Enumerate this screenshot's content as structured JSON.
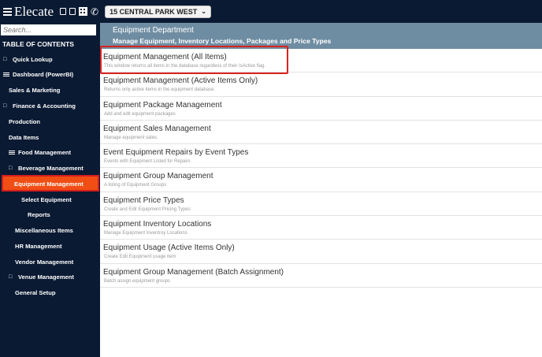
{
  "topbar": {
    "logo": "Elecate",
    "venue_selector": "15 CENTRAL PARK WEST",
    "icons": [
      "menu-icon",
      "window-icon",
      "window-icon",
      "building-icon",
      "phone-icon",
      "chevron-down-icon"
    ]
  },
  "sidebar": {
    "search_placeholder": "Search...",
    "toc_title": "TABLE OF CONTENTS",
    "items": [
      {
        "label": "Quick Lookup"
      },
      {
        "label": "Dashboard (PowerBI)"
      },
      {
        "label": "Sales & Marketing"
      },
      {
        "label": "Finance & Accounting"
      },
      {
        "label": "Production"
      },
      {
        "label": "Data Items"
      },
      {
        "label": "Food Management"
      },
      {
        "label": "Beverage Management"
      },
      {
        "label": "Equipment Management"
      },
      {
        "label": "Select Equipment"
      },
      {
        "label": "Reports"
      },
      {
        "label": "Miscellaneous Items"
      },
      {
        "label": "HR Management"
      },
      {
        "label": "Vendor Management"
      },
      {
        "label": "Venue Management"
      },
      {
        "label": "General Setup"
      }
    ]
  },
  "header": {
    "title": "Equipment Department",
    "subtitle": "Manage Equipment, Inventory Locations, Packages and Price Types"
  },
  "rows": [
    {
      "title": "Equipment Management (All Items)",
      "desc": "This window returns all items in the database regardless of their IsActive flag."
    },
    {
      "title": "Equipment Management (Active Items Only)",
      "desc": "Returns only active items in the equipment database."
    },
    {
      "title": "Equipment Package Management",
      "desc": "Add and edit equipment packages"
    },
    {
      "title": "Equipment Sales Management",
      "desc": "Manage equipment sales."
    },
    {
      "title": "Event Equipment Repairs by Event Types",
      "desc": "Events with Equipment Listed for Repairs"
    },
    {
      "title": "Equipment Group Management",
      "desc": "A listing of Equipment Groups"
    },
    {
      "title": "Equipment Price Types",
      "desc": "Create and Edit Equipment Pricing Types"
    },
    {
      "title": "Equipment Inventory Locations",
      "desc": "Manage Equipment Inventroy Locations"
    },
    {
      "title": "Equipment Usage (Active Items Only)",
      "desc": "Create Edit Equipment usage item"
    },
    {
      "title": "Equipment Group Management (Batch Assignment)",
      "desc": "Batch assign equipment groups"
    }
  ],
  "colors": {
    "nav_background": "#0b1a33",
    "header_background": "#6f8da2",
    "active_item": "#f04e14",
    "highlight_border": "#d9231e"
  }
}
